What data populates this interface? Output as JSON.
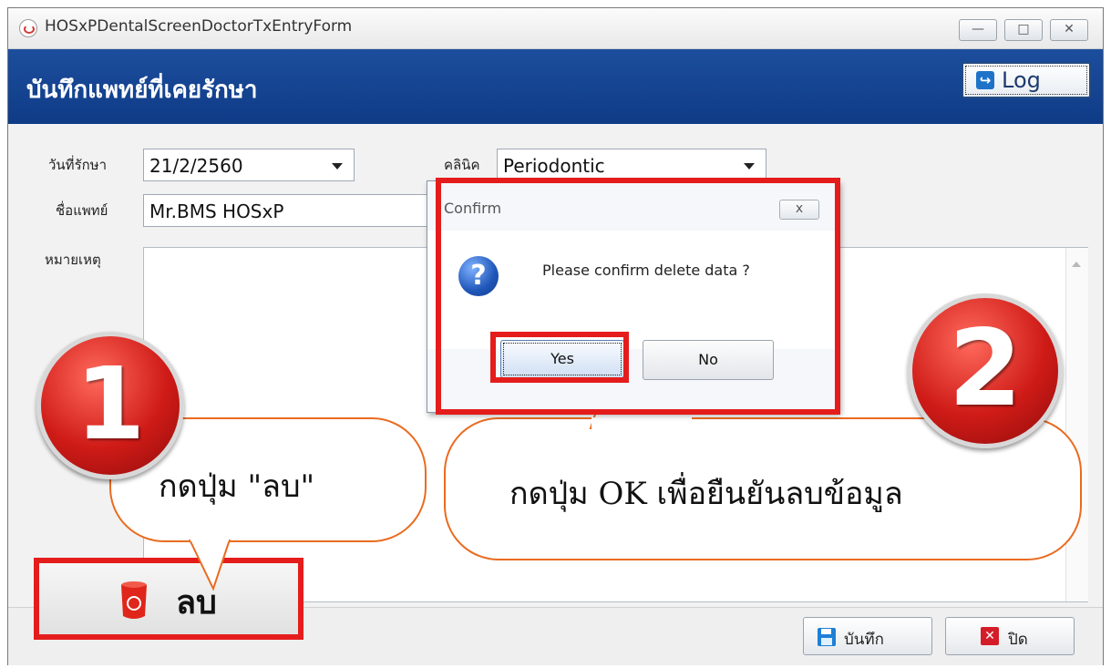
{
  "window": {
    "title": "HOSxPDentalScreenDoctorTxEntryForm",
    "buttons": [
      "—",
      "□",
      "✕"
    ]
  },
  "header": {
    "title": "บันทึกแพทย์ที่เคยรักษา",
    "log_label": "Log"
  },
  "form": {
    "date_label": "วันที่รักษา",
    "date_value": "21/2/2560",
    "clinic_label": "คลินิค",
    "clinic_value": "Periodontic",
    "doctor_label": "ชื่อแพทย์",
    "doctor_value": "Mr.BMS HOSxP",
    "note_label": "หมายเหตุ"
  },
  "footer": {
    "delete_label": "ลบ",
    "save_label": "บันทึก",
    "close_label": "ปิด"
  },
  "dialog": {
    "title": "Confirm",
    "close": "x",
    "message": "Please confirm delete data ?",
    "yes": "Yes",
    "no": "No"
  },
  "annotations": {
    "step1_badge": "1",
    "step1_text": "กดปุ่ม  \"ลบ\"",
    "step2_badge": "2",
    "step2_text": "กดปุ่ม OK เพื่อยืนยันลบข้อมูล"
  },
  "colors": {
    "header": "#0f3b86",
    "highlight": "#e51c1c",
    "callout_border": "#ea6b1f"
  }
}
